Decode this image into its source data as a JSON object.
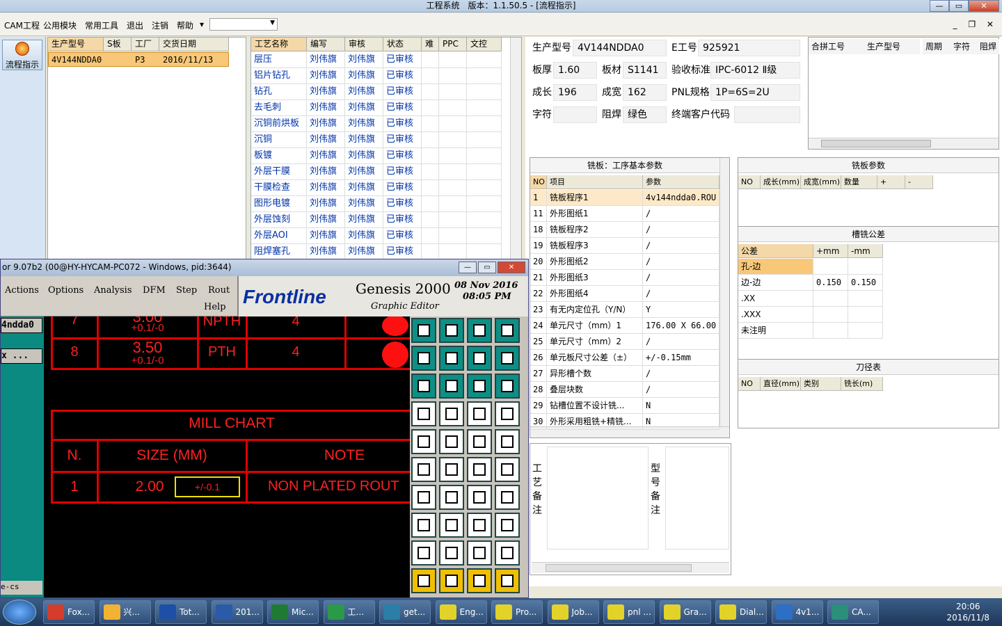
{
  "window": {
    "title": "工程系统　版本：1.1.50.5 - [流程指示]",
    "min": "—",
    "max": "▭",
    "close": "✕"
  },
  "menu": [
    "CAM工程",
    "公用模块",
    "常用工具",
    "退出",
    "注销",
    "帮助",
    "▾"
  ],
  "mdi_buttons": "_ ❐ ✕",
  "flow_button": "流程指示",
  "orders": {
    "headers": [
      "生产型号",
      "S板",
      "工厂",
      "交货日期"
    ],
    "rows": [
      [
        "4V144NDDA0",
        "",
        "P3",
        "2016/11/13"
      ]
    ]
  },
  "process": {
    "headers": [
      "工艺名称",
      "编写",
      "审核",
      "状态",
      "难",
      "PPC",
      "文控"
    ],
    "rows": [
      [
        "层压",
        "刘伟旗",
        "刘伟旗",
        "已审核"
      ],
      [
        "铝片钻孔",
        "刘伟旗",
        "刘伟旗",
        "已审核"
      ],
      [
        "钻孔",
        "刘伟旗",
        "刘伟旗",
        "已审核"
      ],
      [
        "去毛刺",
        "刘伟旗",
        "刘伟旗",
        "已审核"
      ],
      [
        "沉铜前烘板",
        "刘伟旗",
        "刘伟旗",
        "已审核"
      ],
      [
        "沉铜",
        "刘伟旗",
        "刘伟旗",
        "已审核"
      ],
      [
        "板镀",
        "刘伟旗",
        "刘伟旗",
        "已审核"
      ],
      [
        "外层干膜",
        "刘伟旗",
        "刘伟旗",
        "已审核"
      ],
      [
        "干膜检查",
        "刘伟旗",
        "刘伟旗",
        "已审核"
      ],
      [
        "图形电镀",
        "刘伟旗",
        "刘伟旗",
        "已审核"
      ],
      [
        "外层蚀刻",
        "刘伟旗",
        "刘伟旗",
        "已审核"
      ],
      [
        "外层AOI",
        "刘伟旗",
        "刘伟旗",
        "已审核"
      ],
      [
        "阻焊塞孔",
        "刘伟旗",
        "刘伟旗",
        "已审核"
      ]
    ]
  },
  "info": {
    "model_label": "生产型号",
    "model": "4V144NDDA0",
    "e_label": "E工号",
    "e": "925921",
    "thick_label": "板厚",
    "thick": "1.60",
    "mat_label": "板材",
    "mat": "S1141",
    "std_label": "验收标准",
    "std": "IPC-6012 Ⅱ级",
    "len_label": "成长",
    "len": "196",
    "wid_label": "成宽",
    "wid": "162",
    "pnl_label": "PNL规格",
    "pnl": "1P=6S=2U",
    "char_label": "字符",
    "char": "",
    "mask_label": "阻焊",
    "mask": "绿色",
    "cust_label": "终端客户代码",
    "cust": ""
  },
  "combine": {
    "headers": [
      "合拼工号",
      "生产型号",
      "周期",
      "字符",
      "阻焊"
    ]
  },
  "mill": {
    "title": "铣板：工序基本参数",
    "headers": [
      "NO",
      "项目",
      "参数"
    ],
    "rows": [
      [
        "1",
        "铣板程序1",
        "4v144ndda0.ROU"
      ],
      [
        "11",
        "外形图纸1",
        "/"
      ],
      [
        "18",
        "铣板程序2",
        "/"
      ],
      [
        "19",
        "铣板程序3",
        "/"
      ],
      [
        "20",
        "外形图纸2",
        "/"
      ],
      [
        "21",
        "外形图纸3",
        "/"
      ],
      [
        "22",
        "外形图纸4",
        "/"
      ],
      [
        "23",
        "有无内定位孔（Y/N）",
        "Y"
      ],
      [
        "24",
        "单元尺寸（mm）1",
        "176.00 X 66.00"
      ],
      [
        "25",
        "单元尺寸（mm）2",
        "/"
      ],
      [
        "26",
        "单元板尺寸公差（±）",
        "+/-0.15mm"
      ],
      [
        "27",
        "异形槽个数",
        "/"
      ],
      [
        "28",
        "叠层块数",
        "/"
      ],
      [
        "29",
        "钻槽位置不设计铣...",
        "N"
      ],
      [
        "30",
        "外形采用粗铣+精铣...",
        "N"
      ]
    ]
  },
  "millparams": {
    "title": "铣板参数",
    "headers": [
      "NO",
      "成长(mm)",
      "成宽(mm)",
      "数量",
      "+",
      "-"
    ]
  },
  "tolerance": {
    "title": "槽铣公差",
    "headers": [
      "公差",
      "+mm",
      "-mm"
    ],
    "rows": [
      [
        "孔-边",
        "",
        ""
      ],
      [
        "边-边",
        "0.150",
        "0.150"
      ],
      [
        ".XX",
        "",
        ""
      ],
      [
        ".XXX",
        "",
        ""
      ],
      [
        "未注明",
        "",
        ""
      ]
    ]
  },
  "tools": {
    "title": "刀径表",
    "headers": [
      "NO",
      "直径(mm)",
      "类别",
      "铣长(m)"
    ]
  },
  "notes": {
    "proc": "工艺备注",
    "model": "型号备注"
  },
  "genesis": {
    "title": "or 9.07b2 (00@HY-HYCAM-PC072 - Windows, pid:3644)",
    "menu": [
      "Actions",
      "Options",
      "Analysis",
      "DFM",
      "Step",
      "Rout",
      "Help"
    ],
    "brand": "Frontline",
    "product": "Genesis 2000",
    "subtitle": "Graphic Editor",
    "date": "08 Nov 2016",
    "time": "08:05 PM",
    "job": "4ndda0",
    "field": "x ...",
    "bottom": "e-cs",
    "cad": {
      "r7n": "7",
      "r7s": "3.00",
      "r7t": "+0.1/-0",
      "r7k": "NPTH",
      "r7q": "4",
      "r8n": "8",
      "r8s": "3.50",
      "r8t": "+0.1/-0",
      "r8k": "PTH",
      "r8q": "4",
      "mill": "MILL CHART",
      "h1": "N.",
      "h2": "SIZE (MM)",
      "h3": "NOTE",
      "d1": "1",
      "d2": "2.00",
      "d3": "+/-0.1",
      "d4": "NON PLATED ROUT"
    }
  },
  "taskbar": {
    "items": [
      "Fox...",
      "兴...",
      "Tot...",
      "201...",
      "Mic...",
      "工...",
      "get...",
      "Eng...",
      "Pro...",
      "Job...",
      "pnl ...",
      "Gra...",
      "Dial...",
      "4v1...",
      "CA..."
    ],
    "time": "20:06",
    "date": "2016/11/8"
  }
}
